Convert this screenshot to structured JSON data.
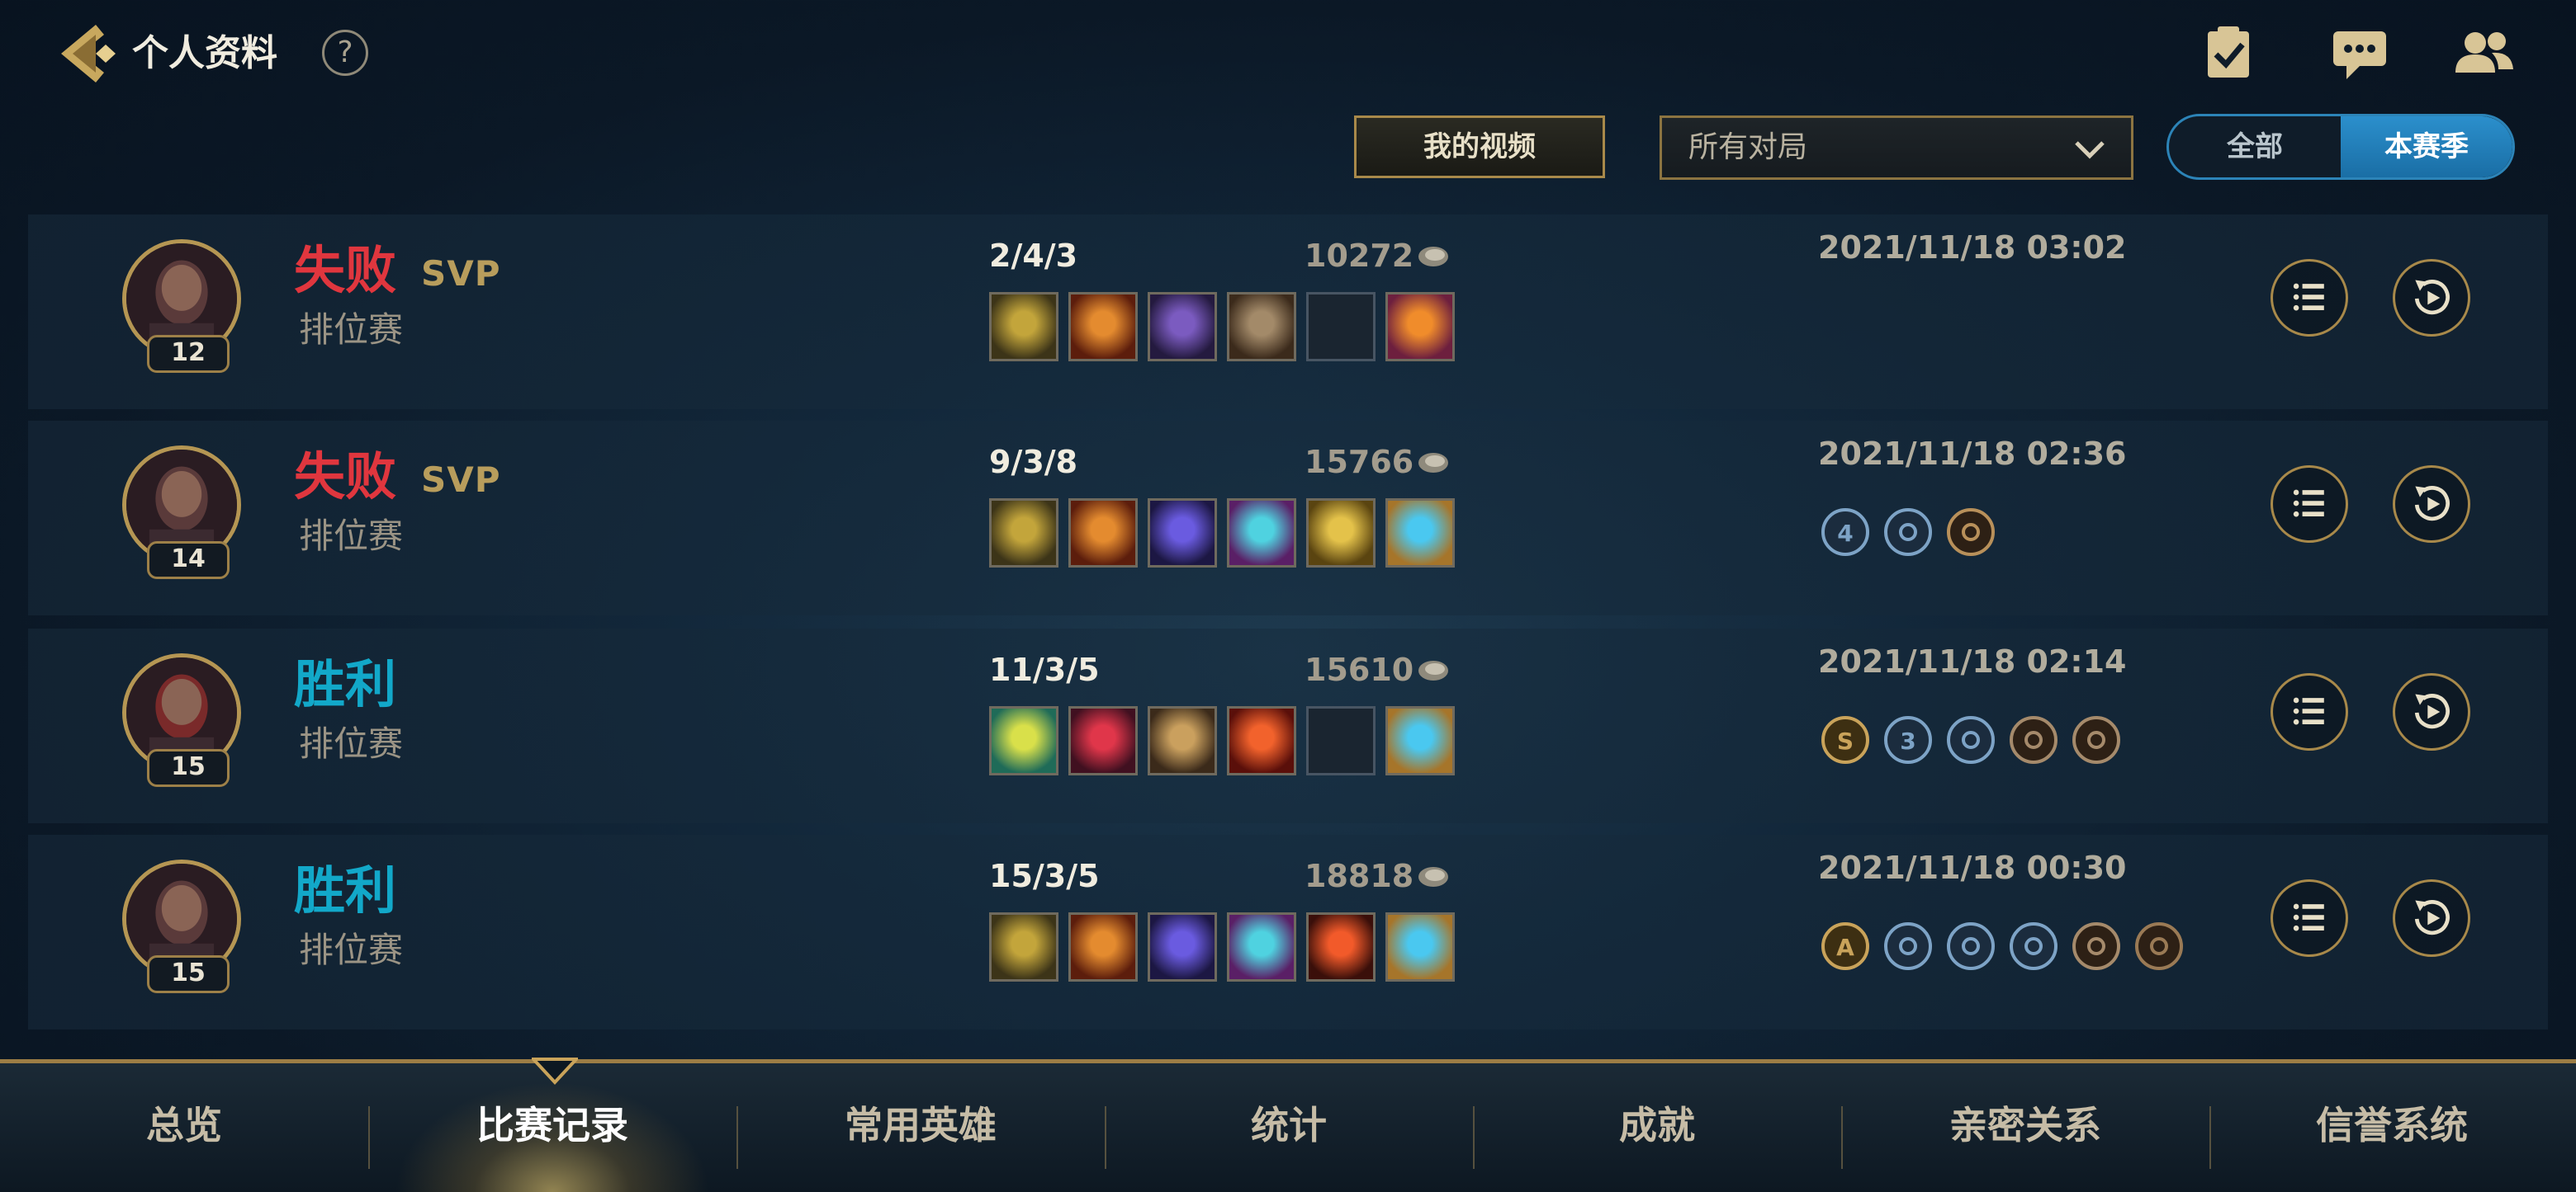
{
  "header": {
    "title": "个人资料",
    "help_label": "?",
    "icons": [
      "back-icon",
      "help-icon",
      "task-icon",
      "chat-icon",
      "friends-icon"
    ]
  },
  "filters": {
    "video_button": "我的视频",
    "match_type": "所有对局",
    "toggle": {
      "all": "全部",
      "season": "本赛季",
      "selected": "本赛季"
    }
  },
  "matches": [
    {
      "result": "失败",
      "result_type": "loss",
      "mvp": "SVP",
      "mode": "排位赛",
      "level": "12",
      "kda": "2/4/3",
      "score": "10272",
      "time": "2021/11/18 03:02",
      "items": [
        "item-saber",
        "item-flame-staff",
        "item-purple-cloak",
        "item-hammer",
        "empty",
        "item-beast-mask"
      ],
      "badges": []
    },
    {
      "result": "失败",
      "result_type": "loss",
      "mvp": "SVP",
      "mode": "排位赛",
      "level": "14",
      "kda": "9/3/8",
      "score": "15766",
      "time": "2021/11/18 02:36",
      "items": [
        "item-saber",
        "item-flame-staff",
        "item-void-blade",
        "item-ice-claw",
        "item-gold-cross",
        "item-speed-boots"
      ],
      "badges": [
        "4",
        "flag",
        "drop"
      ]
    },
    {
      "result": "胜利",
      "result_type": "win",
      "mvp": "",
      "mode": "排位赛",
      "level": "15",
      "kda": "11/3/5",
      "score": "15610",
      "time": "2021/11/18 02:14",
      "items": [
        "item-shield-gem",
        "item-blood-claw",
        "item-gold-armor",
        "item-fire-orb",
        "empty",
        "item-speed-boots"
      ],
      "badges": [
        "S",
        "3",
        "swords",
        "leaf",
        "tower"
      ]
    },
    {
      "result": "胜利",
      "result_type": "win",
      "mvp": "",
      "mode": "排位赛",
      "level": "15",
      "kda": "15/3/5",
      "score": "18818",
      "time": "2021/11/18 00:30",
      "items": [
        "item-saber",
        "item-flame-staff",
        "item-void-blade",
        "item-ice-claw",
        "item-red-blade",
        "item-speed-boots"
      ],
      "badges": [
        "A",
        "flame",
        "fire",
        "swords",
        "leaf",
        "crown"
      ]
    }
  ],
  "tabs": [
    {
      "label": "总览",
      "active": false
    },
    {
      "label": "比赛记录",
      "active": true
    },
    {
      "label": "常用英雄",
      "active": false
    },
    {
      "label": "统计",
      "active": false
    },
    {
      "label": "成就",
      "active": false
    },
    {
      "label": "亲密关系",
      "active": false
    },
    {
      "label": "信誉系统",
      "active": false
    }
  ],
  "colors": {
    "loss": "#e0363e",
    "win": "#12a8c9",
    "gold": "#a8894a",
    "accent_blue": "#2b8fcc"
  }
}
